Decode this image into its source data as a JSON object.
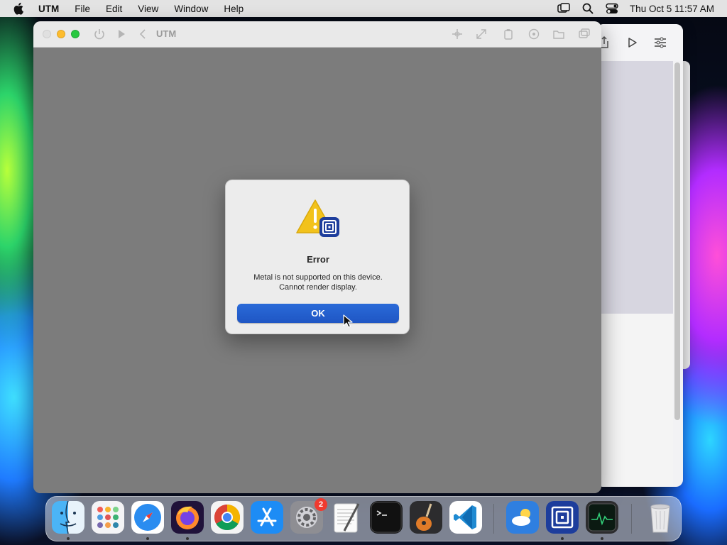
{
  "menubar": {
    "app_name": "UTM",
    "items": [
      "File",
      "Edit",
      "View",
      "Window",
      "Help"
    ],
    "datetime": "Thu Oct 5  11:57 AM"
  },
  "window": {
    "title": "UTM"
  },
  "alert": {
    "title": "Error",
    "message_line1": "Metal is not supported on this device.",
    "message_line2": "Cannot render display.",
    "ok_label": "OK"
  },
  "dock": {
    "apps": [
      "Finder",
      "Launchpad",
      "Safari",
      "Firefox",
      "Chrome",
      "App Store",
      "System Settings",
      "TextEdit",
      "Terminal",
      "GarageBand",
      "Visual Studio Code",
      "Weather",
      "UTM",
      "Activity Monitor",
      "Trash"
    ],
    "settings_badge": "2"
  },
  "colors": {
    "accent": "#1f56c4",
    "display_bg": "#7c7c7c",
    "alert_bg": "#ececec"
  }
}
